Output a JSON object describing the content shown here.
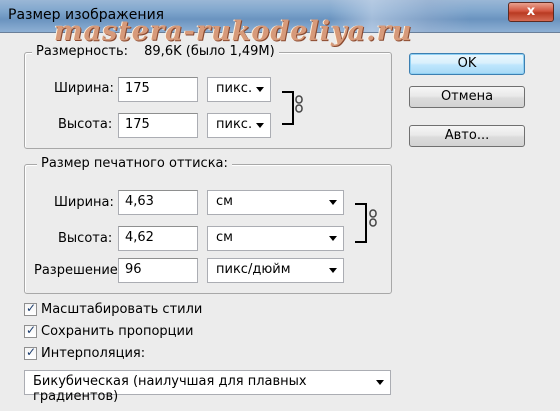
{
  "window": {
    "title": "Размер изображения",
    "close_label": "x",
    "watermark": "mastera-rukodeliya.ru"
  },
  "pixel_dimensions": {
    "label": "Размерность:",
    "value": "89,6K (было 1,49M)",
    "width_label": "Ширина:",
    "width_value": "175",
    "width_unit": "пикс.",
    "height_label": "Высота:",
    "height_value": "175",
    "height_unit": "пикс."
  },
  "document_size": {
    "label": "Размер печатного оттиска:",
    "width_label": "Ширина:",
    "width_value": "4,63",
    "width_unit": "см",
    "height_label": "Высота:",
    "height_value": "4,62",
    "height_unit": "см",
    "resolution_label": "Разрешение:",
    "resolution_value": "96",
    "resolution_unit": "пикс/дюйм"
  },
  "buttons": {
    "ok": "OK",
    "cancel": "Отмена",
    "auto": "Авто..."
  },
  "options": {
    "scale_styles": {
      "label": "Масштабировать стили",
      "checked": true
    },
    "constrain": {
      "label": "Сохранить пропорции",
      "checked": true
    },
    "resample": {
      "label": "Интерполяция:",
      "checked": true
    }
  },
  "resample_method": "Бикубическая (наилучшая для плавных градиентов)",
  "icons": {
    "chain": "chain-link-icon",
    "dropdown": "chevron-down-icon",
    "check": "checkmark-icon"
  }
}
